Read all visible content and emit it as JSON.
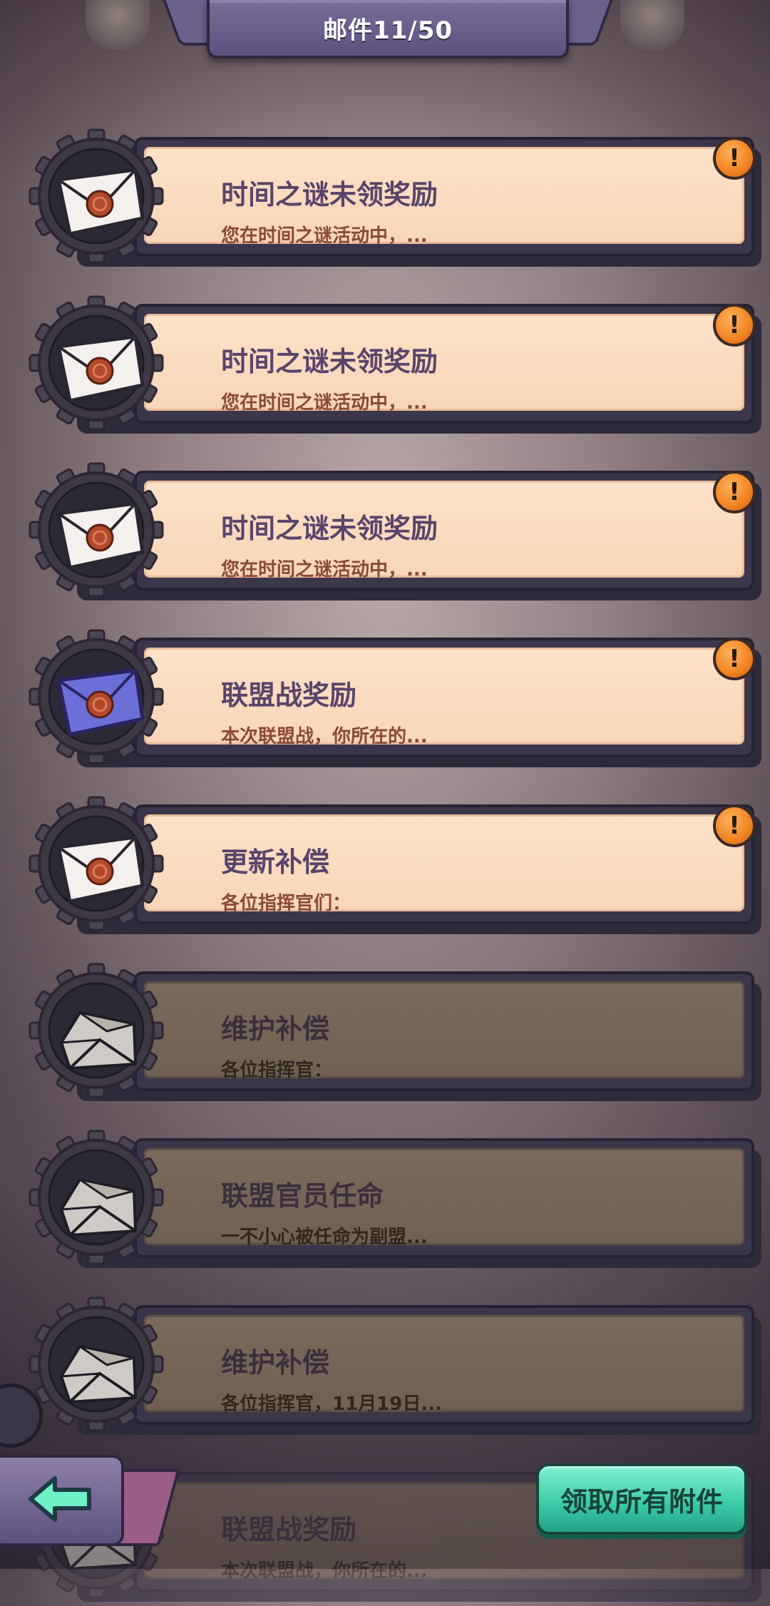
{
  "header": {
    "title": "邮件11/50"
  },
  "mails": [
    {
      "title": "时间之谜未领奖励",
      "preview": "您在时间之谜活动中，...",
      "icon": "envelope-sealed-icon",
      "status": "unread",
      "alert": "!"
    },
    {
      "title": "时间之谜未领奖励",
      "preview": "您在时间之谜活动中，...",
      "icon": "envelope-sealed-icon",
      "status": "unread",
      "alert": "!"
    },
    {
      "title": "时间之谜未领奖励",
      "preview": "您在时间之谜活动中，...",
      "icon": "envelope-sealed-icon",
      "status": "unread",
      "alert": "!"
    },
    {
      "title": "联盟战奖励",
      "preview": "本次联盟战，你所在的...",
      "icon": "envelope-blue-sealed-icon",
      "status": "unread",
      "alert": "!"
    },
    {
      "title": "更新补偿",
      "preview": "各位指挥官们：",
      "icon": "envelope-sealed-icon",
      "status": "unread",
      "alert": "!"
    },
    {
      "title": "维护补偿",
      "preview": "各位指挥官：",
      "icon": "envelope-open-icon",
      "status": "read"
    },
    {
      "title": "联盟官员任命",
      "preview": "一不小心被任命为副盟...",
      "icon": "envelope-open-icon",
      "status": "read"
    },
    {
      "title": "维护补偿",
      "preview": "各位指挥官，11月19日...",
      "icon": "envelope-open-icon",
      "status": "read"
    },
    {
      "title": "联盟战奖励",
      "preview": "本次联盟战，你所在的...",
      "icon": "envelope-open-icon",
      "status": "read"
    }
  ],
  "footer": {
    "claim_all_label": "领取所有附件",
    "back_icon": "back-arrow-icon"
  },
  "colors": {
    "accent_claim": "#38c9a6",
    "alert": "#f08322",
    "header": "#6b5f8c"
  }
}
